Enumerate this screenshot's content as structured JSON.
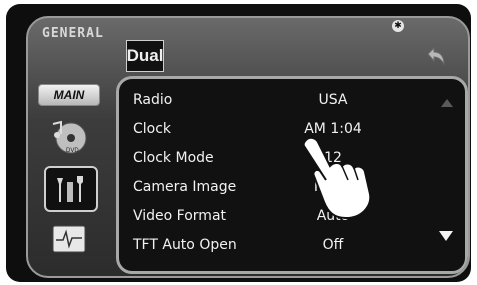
{
  "header": {
    "section_label": "GENERAL",
    "logo_text": "Dual",
    "bluetooth_icon": "bluetooth-icon",
    "back_icon": "back-arrow-icon"
  },
  "sidebar": {
    "main_label": "MAIN",
    "items": [
      {
        "icon": "music-dvd-icon"
      },
      {
        "icon": "tools-settings-icon"
      },
      {
        "icon": "screen-waveform-icon"
      }
    ]
  },
  "settings": {
    "rows": [
      {
        "label": "Radio",
        "value": "USA"
      },
      {
        "label": "Clock",
        "value": "AM  1:04"
      },
      {
        "label": "Clock Mode",
        "value": "12"
      },
      {
        "label": "Camera Image",
        "value": "Norm"
      },
      {
        "label": "Video Format",
        "value": "Auto"
      },
      {
        "label": "TFT Auto Open",
        "value": "Off"
      }
    ],
    "scroll_up_icon": "arrow-up-icon",
    "scroll_down_icon": "arrow-down-icon"
  },
  "overlay": {
    "icon": "pointing-hand-icon"
  },
  "colors": {
    "panel_bg": "#111111",
    "screen_bg": "#3c3c3c",
    "text": "#f2f2f2",
    "border": "#a8a8a8"
  }
}
